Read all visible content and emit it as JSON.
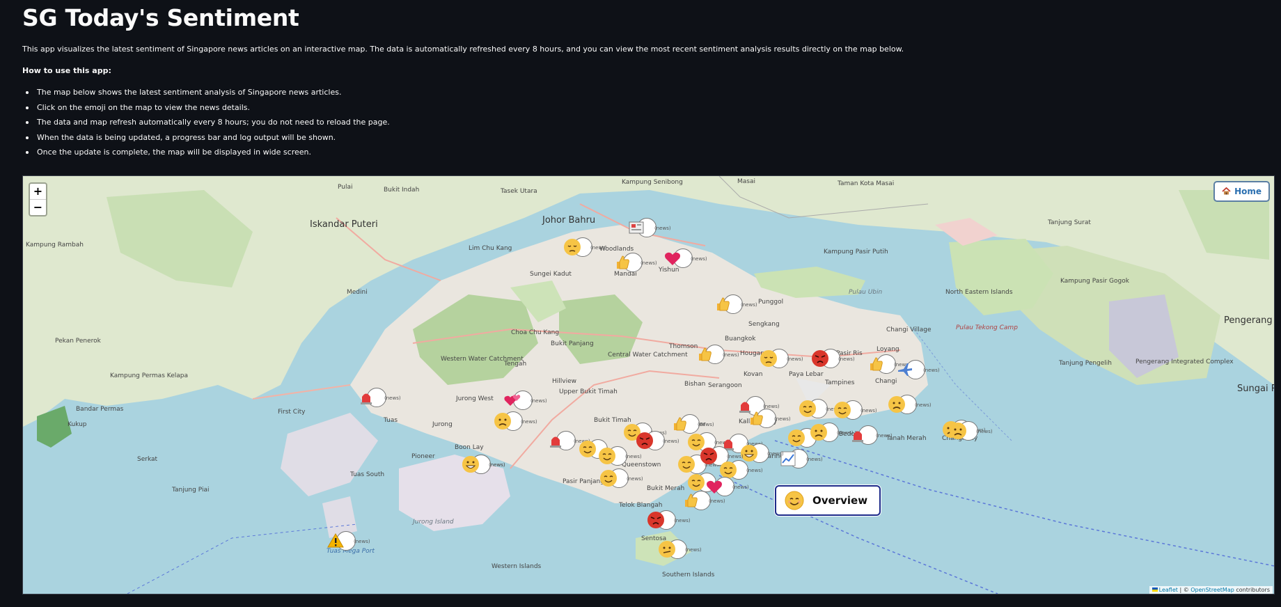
{
  "page": {
    "title": "SG Today's Sentiment",
    "description": "This app visualizes the latest sentiment of Singapore news articles on an interactive map. The data is automatically refreshed every 8 hours, and you can view the most recent sentiment analysis results directly on the map below.",
    "howto_heading": "How to use this app:",
    "steps": [
      "The map below shows the latest sentiment analysis of Singapore news articles.",
      "Click on the emoji on the map to view the news details.",
      "The data and map refresh automatically every 8 hours; you do not need to reload the page.",
      "When the data is being updated, a progress bar and log output will be shown.",
      "Once the update is complete, the map will be displayed in wide screen."
    ]
  },
  "map": {
    "zoom_in": "+",
    "zoom_out": "−",
    "home_label": "Home",
    "overview_label": "Overview",
    "marker_badge": "(news)",
    "attribution": {
      "leaflet": "Leaflet",
      "separator": " | © ",
      "osm": "OpenStreetMap",
      "suffix": " contributors"
    },
    "places": {
      "pulai": "Pulai",
      "bukit_indah": "Bukit Indah",
      "tasek_utara": "Tasek Utara",
      "kampung_senibong": "Kampung Senibong",
      "masai": "Masai",
      "taman_kota_masai": "Taman Kota Masai",
      "iskandar_puteri": "Iskandar Puteri",
      "johor_bahru": "Johor Bahru",
      "tanjung_surat": "Tanjung Surat",
      "kampung_rambah": "Kampung Rambah",
      "lim_chu_kang": "Lim Chu Kang",
      "sungei_kadut": "Sungei Kadut",
      "woodlands": "Woodlands",
      "mandai": "Mandai",
      "yishun": "Yishun",
      "kampung_pasir_putih": "Kampung Pasir Putih",
      "pulau_ubin": "Pulau Ubin",
      "north_eastern_islands": "North Eastern Islands",
      "punggol": "Punggol",
      "sengkang": "Sengkang",
      "medini": "Medini",
      "pekan_penerok": "Pekan Penerok",
      "western_water_catchment": "Western Water Catchment",
      "tengah": "Tengah",
      "choa_chu_kang": "Choa Chu Kang",
      "bukit_panjang": "Bukit Panjang",
      "central_water_catchment": "Central Water Catchment",
      "thomson": "Thomson",
      "buangkok": "Buangkok",
      "hougang": "Hougang",
      "pasir_ris": "Pasir Ris",
      "changi_village": "Changi Village",
      "loyang": "Loyang",
      "pulau_tekong_camp": "Pulau Tekong Camp",
      "pengerang": "Pengerang",
      "tanjung_pengelih": "Tanjung Pengelih",
      "pengerang_integrated_complex": "Pengerang Integrated Complex",
      "sungai_rengit": "Sungai Reng",
      "jurong_west": "Jurong West",
      "hillview": "Hillview",
      "upper_bukit_timah": "Upper Bukit Timah",
      "bishan": "Bishan",
      "serangoon": "Serangoon",
      "kovan": "Kovan",
      "paya_lebar": "Paya Lebar",
      "tampines": "Tampines",
      "changi": "Changi",
      "kukup": "Kukup",
      "bandar_permas": "Bandar Permas",
      "first_city": "First City",
      "tuas": "Tuas",
      "jurong": "Jurong",
      "bukit_timah": "Bukit Timah",
      "balestier": "Balestier",
      "kallang_way": "Kallang Way",
      "bedok": "Bedok",
      "tanah_merah": "Tanah Merah",
      "changi_bay": "Changi Bay",
      "boon_lay": "Boon Lay",
      "pioneer": "Pioneer",
      "queenstown": "Queenstown",
      "marine_parade": "Marine Parade",
      "tuas_south": "Tuas South",
      "jurong_island": "Jurong Island",
      "pasir_panjang": "Pasir Panjang",
      "bukit_merah": "Bukit Merah",
      "telok_blangah": "Telok Blangah",
      "sentosa": "Sentosa",
      "tuas_mega_port": "Tuas Mega Port",
      "western_islands": "Western Islands",
      "southern_islands": "Southern Islands",
      "tanjung_piai": "Tanjung Piai",
      "serkat": "Serkat",
      "kampung_permas_kelapa": "Kampung Permas Kelapa",
      "kampung_pasir_gogok": "Kampung Pasir Gogok"
    }
  }
}
